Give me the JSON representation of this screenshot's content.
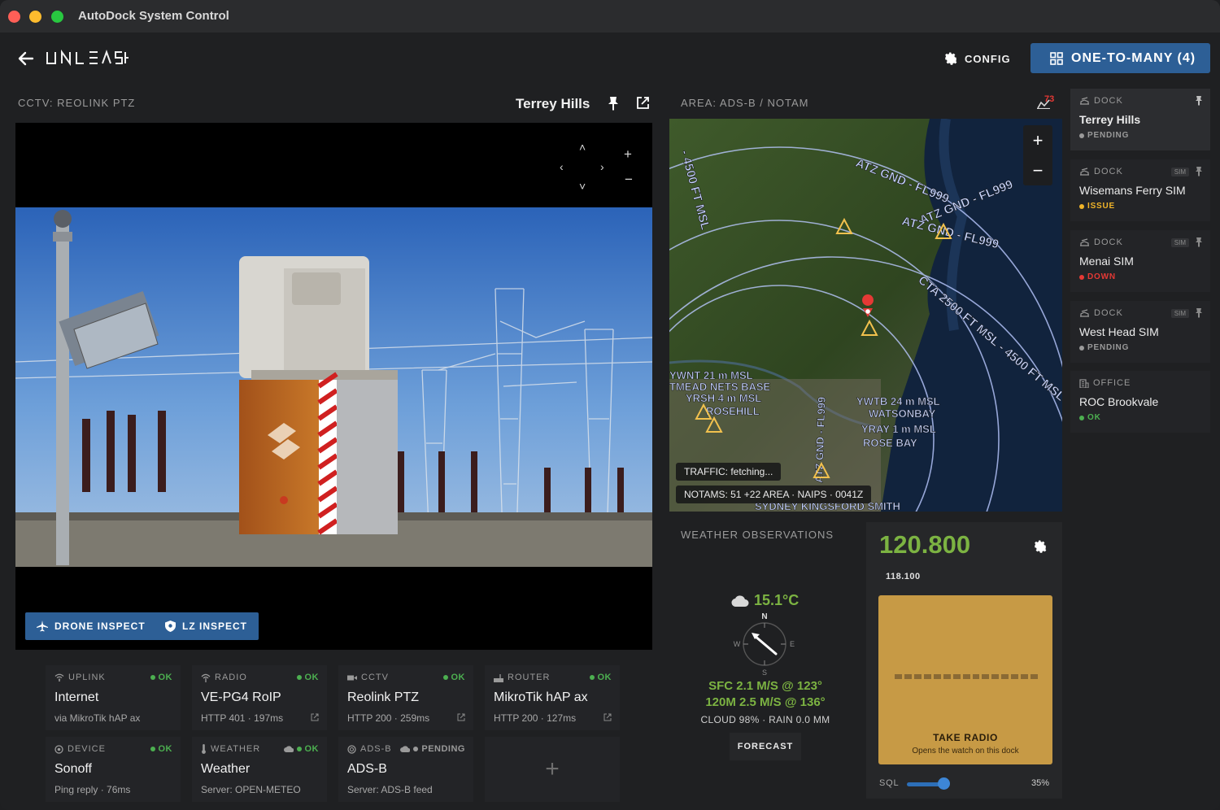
{
  "window": {
    "title": "AutoDock System Control"
  },
  "header": {
    "logo": "UNLEASH",
    "config_label": "CONFIG",
    "one_to_many_label": "ONE-TO-MANY (4)"
  },
  "cctv": {
    "panel_label": "CCTV: REOLINK PTZ",
    "title": "Terrey Hills",
    "drone_inspect_label": "DRONE INSPECT",
    "lz_inspect_label": "LZ INSPECT"
  },
  "status_tiles": [
    {
      "category": "UPLINK",
      "status": "OK",
      "name": "Internet",
      "sub": "via MikroTik hAP ax",
      "icon": "wifi-icon"
    },
    {
      "category": "RADIO",
      "status": "OK",
      "name": "VE-PG4 RoIP",
      "sub": "HTTP 401 · 197ms",
      "icon": "radio-icon"
    },
    {
      "category": "CCTV",
      "status": "OK",
      "name": "Reolink PTZ",
      "sub": "HTTP 200 · 259ms",
      "icon": "camera-icon"
    },
    {
      "category": "ROUTER",
      "status": "OK",
      "name": "MikroTik hAP ax",
      "sub": "HTTP 200 · 127ms",
      "icon": "router-icon"
    },
    {
      "category": "DEVICE",
      "status": "OK",
      "name": "Sonoff",
      "sub": "Ping reply · 76ms",
      "icon": "device-icon"
    },
    {
      "category": "WEATHER",
      "status": "OK",
      "name": "Weather",
      "sub": "Server: OPEN-METEO",
      "icon": "thermometer-icon"
    },
    {
      "category": "ADS-B",
      "status": "PENDING",
      "name": "ADS-B",
      "sub": "Server: ADS-B feed",
      "icon": "radar-icon"
    }
  ],
  "add_tile": {
    "label": "+"
  },
  "map": {
    "panel_label": "AREA: ADS-B / NOTAM",
    "badge": "73",
    "zoom_in": "+",
    "zoom_out": "−",
    "traffic": "TRAFFIC: fetching...",
    "notams": "NOTAMS: 51 +22 AREA · NAIPS · 0041Z",
    "labels": {
      "atz1": "ATZ GND - FL999",
      "atz2": "ATZ GND - FL999",
      "atz3": "ATZ GND - FL999",
      "cta": "CTA 2500 FT MSL - 4500 FT MSL",
      "left_vertical": "- 4500 FT MSL",
      "ywnt": "YWNT 21 m MSL",
      "mead": "TMEAD NETS BASE",
      "yrsh": "YRSH 4 m MSL",
      "rosehill": "ROSEHILL",
      "ywtb": "YWTB 24 m MSL",
      "watson": "WATSONBAY",
      "yray": "YRAY 1 m MSL",
      "rosebay": "ROSE BAY",
      "gnd_vertical": "ATZ GND - FL999",
      "sydney": "SYDNEY KINGSFORD SMITH"
    }
  },
  "weather": {
    "panel_label": "WEATHER OBSERVATIONS",
    "temp": "15.1°C",
    "compass_n": "N",
    "compass_e": "E",
    "compass_s": "S",
    "compass_w": "W",
    "sfc": "SFC  2.1 M/S @ 123°",
    "upper": "120M  2.5 M/S @ 136°",
    "cloud": "CLOUD 98% · RAIN 0.0 MM",
    "forecast_label": "FORECAST"
  },
  "radio": {
    "frequency": "120.800",
    "secondary_frequency": "118.100",
    "take_label": "TAKE RADIO",
    "take_sub": "Opens the watch on this dock",
    "sql_label": "SQL",
    "sql_value": "35%",
    "sql_level": 0.35
  },
  "docks": [
    {
      "type": "DOCK",
      "name": "Terrey Hills",
      "status": "PENDING",
      "sim": "",
      "selected": true
    },
    {
      "type": "DOCK",
      "name": "Wisemans Ferry SIM",
      "status": "ISSUE",
      "sim": "SIM"
    },
    {
      "type": "DOCK",
      "name": "Menai SIM",
      "status": "DOWN",
      "sim": "SIM"
    },
    {
      "type": "DOCK",
      "name": "West Head SIM",
      "status": "PENDING",
      "sim": "SIM"
    },
    {
      "type": "OFFICE",
      "name": "ROC Brookvale",
      "status": "OK",
      "sim": ""
    }
  ],
  "colors": {
    "accent": "#2d5f96",
    "ok": "#4caf50",
    "issue": "#f0b429",
    "down": "#e53935",
    "wx_green": "#7cb342",
    "take_radio": "#c79a45"
  }
}
